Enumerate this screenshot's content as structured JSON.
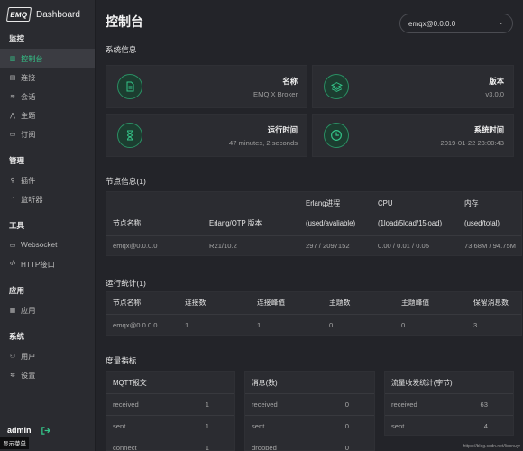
{
  "brand": {
    "logo": "EMQ",
    "title": "Dashboard"
  },
  "sidebar": {
    "sections": [
      {
        "title": "监控",
        "items": [
          {
            "label": "控制台",
            "icon": "bar-chart-icon",
            "active": true
          },
          {
            "label": "连接",
            "icon": "database-icon"
          },
          {
            "label": "会话",
            "icon": "layers-icon"
          },
          {
            "label": "主题",
            "icon": "topic-icon"
          },
          {
            "label": "订阅",
            "icon": "document-icon"
          }
        ]
      },
      {
        "title": "管理",
        "items": [
          {
            "label": "插件",
            "icon": "plug-icon"
          },
          {
            "label": "监听器",
            "icon": "headset-icon"
          }
        ]
      },
      {
        "title": "工具",
        "items": [
          {
            "label": "Websocket",
            "icon": "document-icon"
          },
          {
            "label": "HTTP接口",
            "icon": "code-icon"
          }
        ]
      },
      {
        "title": "应用",
        "items": [
          {
            "label": "应用",
            "icon": "app-icon"
          }
        ]
      },
      {
        "title": "系统",
        "items": [
          {
            "label": "用户",
            "icon": "user-icon"
          },
          {
            "label": "设置",
            "icon": "gear-icon"
          }
        ]
      }
    ],
    "footer": {
      "user": "admin",
      "toggle_label": "显示菜单"
    }
  },
  "header": {
    "title": "控制台",
    "node_select": "emqx@0.0.0.0"
  },
  "system_info": {
    "title": "系统信息",
    "cards": [
      {
        "label": "名称",
        "value": "EMQ X Broker",
        "icon": "file-icon"
      },
      {
        "label": "版本",
        "value": "v3.0.0",
        "icon": "layers-icon"
      },
      {
        "label": "运行时间",
        "value": "47 minutes, 2 seconds",
        "icon": "hourglass-icon"
      },
      {
        "label": "系统时间",
        "value": "2019-01-22 23:00:43",
        "icon": "clock-icon"
      }
    ]
  },
  "node_info": {
    "title": "节点信息(1)",
    "headers": [
      {
        "line1": "",
        "line2": "节点名称"
      },
      {
        "line1": "",
        "line2": "Erlang/OTP 版本"
      },
      {
        "line1": "Erlang进程",
        "line2": "(used/avaliable)"
      },
      {
        "line1": "CPU",
        "line2": "(1load/5load/15load)"
      },
      {
        "line1": "内存",
        "line2": "(used/total)"
      }
    ],
    "rows": [
      [
        "emqx@0.0.0.0",
        "R21/10.2",
        "297 / 2097152",
        "0.00 / 0.01 / 0.05",
        "73.68M / 94.75M"
      ]
    ]
  },
  "run_stats": {
    "title": "运行统计(1)",
    "headers": [
      "节点名称",
      "连接数",
      "连接峰值",
      "主题数",
      "主题峰值",
      "保留消息数"
    ],
    "rows": [
      [
        "emqx@0.0.0.0",
        "1",
        "1",
        "0",
        "0",
        "3"
      ]
    ]
  },
  "metrics": {
    "title": "度量指标",
    "cards": [
      {
        "title": "MQTT报文",
        "rows": [
          [
            "received",
            "1"
          ],
          [
            "sent",
            "1"
          ],
          [
            "connect",
            "1"
          ]
        ]
      },
      {
        "title": "消息(数)",
        "rows": [
          [
            "received",
            "0"
          ],
          [
            "sent",
            "0"
          ],
          [
            "dropped",
            "0"
          ]
        ]
      },
      {
        "title": "流量收发统计(字节)",
        "rows": [
          [
            "received",
            "63"
          ],
          [
            "sent",
            "4"
          ]
        ]
      }
    ]
  },
  "watermark": "https://blog.csdn.net/lisonuyr",
  "colors": {
    "accent": "#34c388",
    "background": "#232429",
    "card": "#2b2c31",
    "sidebar": "#2a2b30"
  }
}
